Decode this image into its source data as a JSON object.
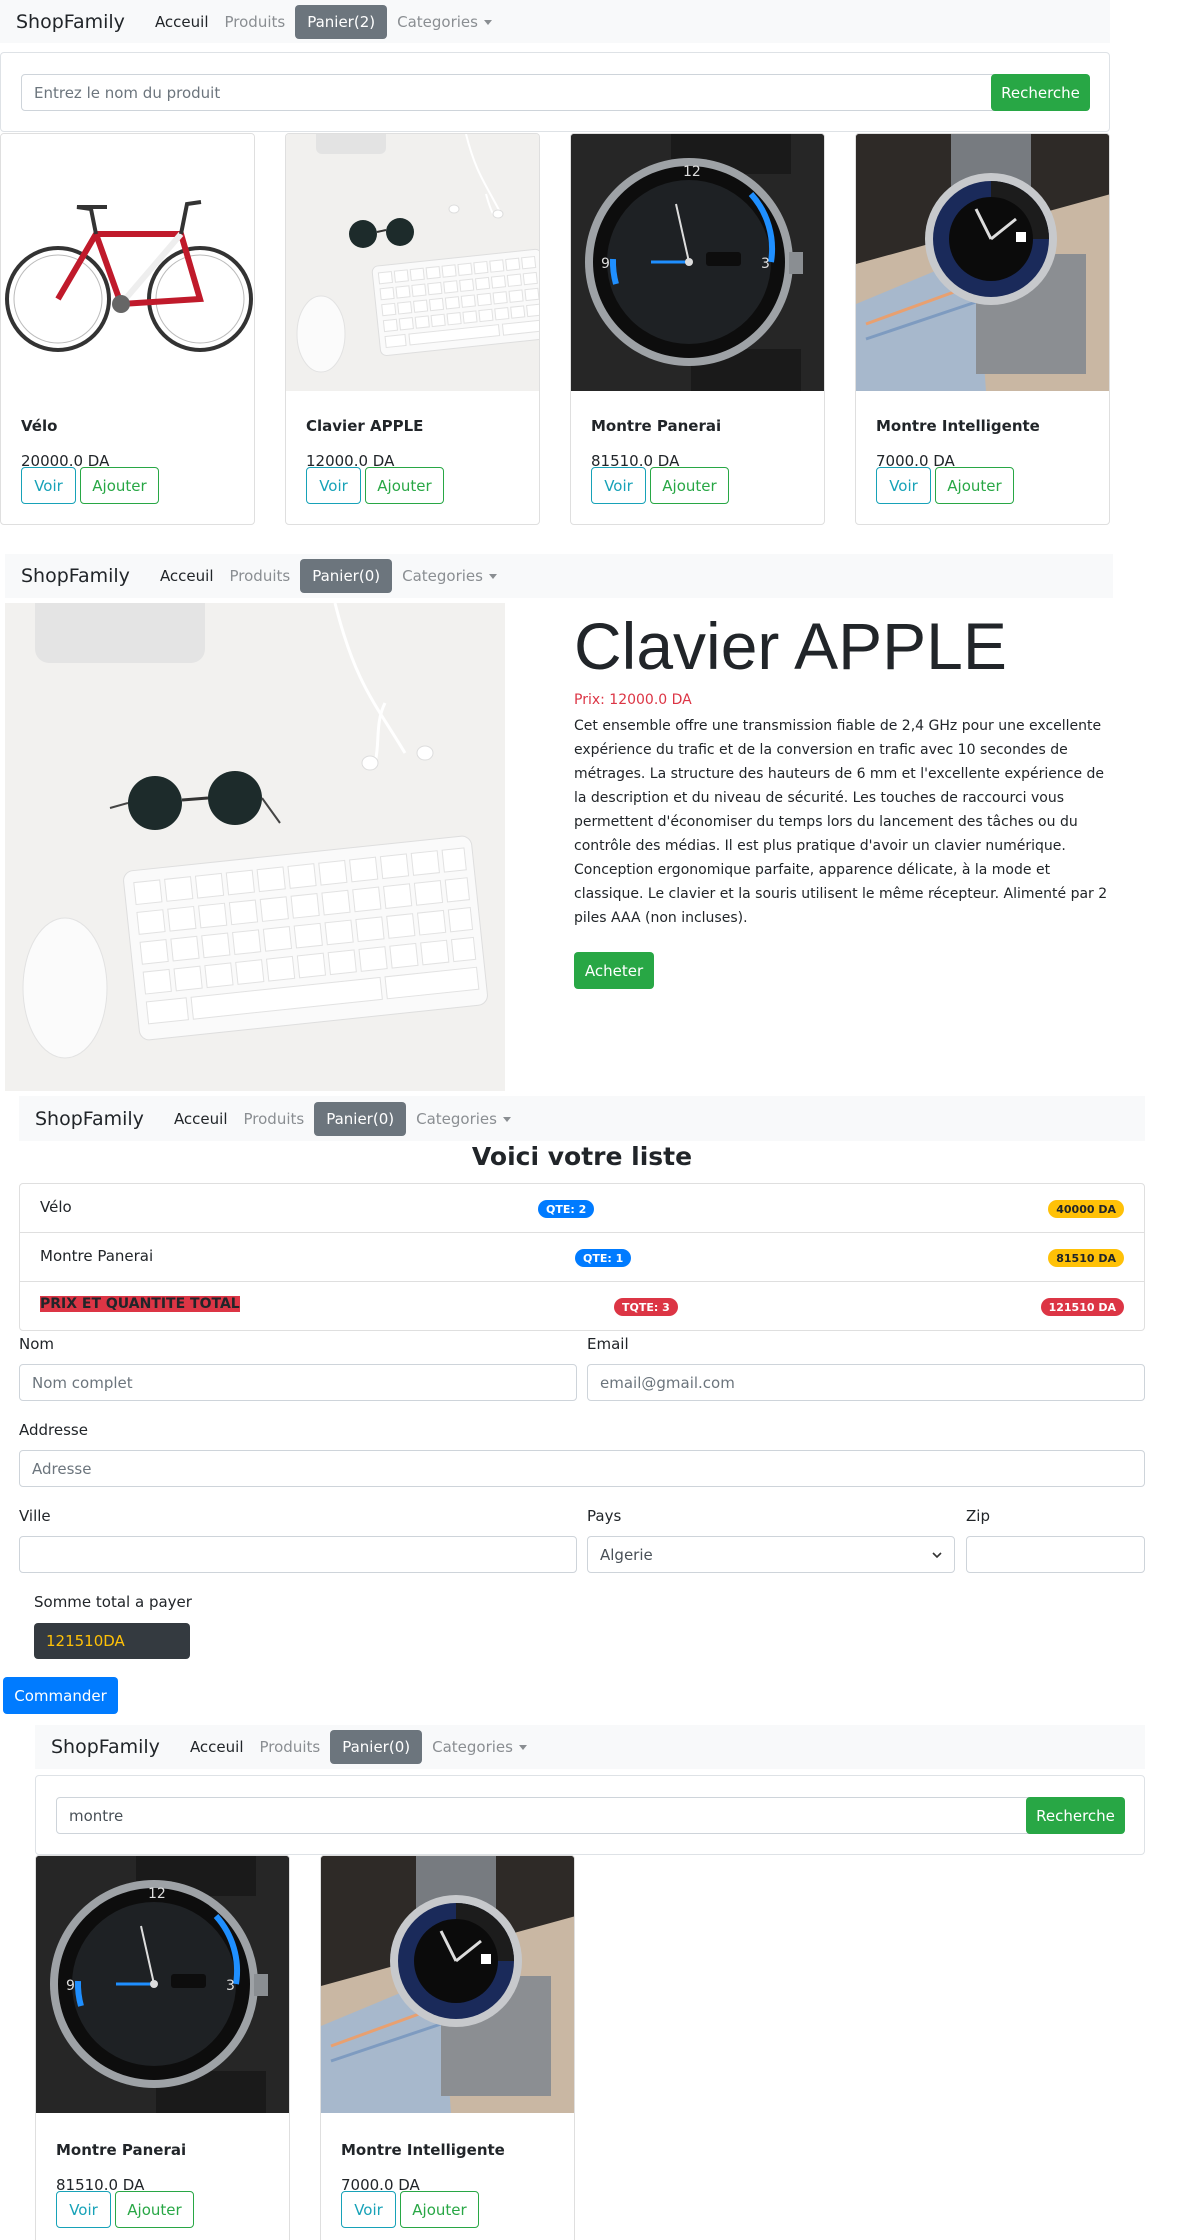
{
  "nav": {
    "brand": "ShopFamily",
    "home": "Acceuil",
    "products": "Produits",
    "cart_2": "Panier(2)",
    "cart_0": "Panier(0)",
    "categories": "Categories"
  },
  "search1": {
    "placeholder": "Entrez le nom du produit",
    "button": "Recherche"
  },
  "products": [
    {
      "name": "Vélo",
      "price": "20000.0 DA"
    },
    {
      "name": "Clavier APPLE",
      "price": "12000.0 DA"
    },
    {
      "name": "Montre Panerai",
      "price": "81510.0 DA"
    },
    {
      "name": "Montre Intelligente",
      "price": "7000.0 DA"
    }
  ],
  "buttons": {
    "view": "Voir",
    "add": "Ajouter"
  },
  "detail": {
    "title": "Clavier APPLE",
    "price": "Prix: 12000.0 DA",
    "description": "Cet ensemble offre une transmission fiable de 2,4 GHz pour une excellente expérience du trafic et de la conversion en trafic avec 10 secondes de métrages. La structure des hauteurs de 6 mm et l'excellente expérience de la description et du niveau de sécurité. Les touches de raccourci vous permettent d'économiser du temps lors du lancement des tâches ou du contrôle des médias. Il est plus pratique d'avoir un clavier numérique. Conception ergonomique parfaite, apparence délicate, à la mode et classique. Le clavier et la souris utilisent le même récepteur. Alimenté par 2 piles AAA (non incluses).",
    "buy": "Acheter"
  },
  "cart": {
    "heading": "Voici votre liste",
    "rows": [
      {
        "name": "Vélo",
        "qty": "QTE: 2",
        "total": "40000 DA"
      },
      {
        "name": "Montre Panerai",
        "qty": "QTE: 1",
        "total": "81510 DA"
      }
    ],
    "total_row": {
      "name": "PRIX ET QUANTITE TOTAL",
      "qty": "TQTE: 3",
      "total": "121510 DA"
    }
  },
  "form": {
    "name_label": "Nom",
    "name_placeholder": "Nom complet",
    "email_label": "Email",
    "email_placeholder": "email@gmail.com",
    "address_label": "Addresse",
    "address_placeholder": "Adresse",
    "city_label": "Ville",
    "country_label": "Pays",
    "country_value": "Algerie",
    "zip_label": "Zip",
    "sum_label": "Somme total a payer",
    "sum_value": "121510DA",
    "order": "Commander"
  },
  "search2": {
    "value": "montre",
    "button": "Recherche"
  },
  "results": [
    {
      "name": "Montre Panerai",
      "price": "81510.0 DA"
    },
    {
      "name": "Montre Intelligente",
      "price": "7000.0 DA"
    }
  ]
}
